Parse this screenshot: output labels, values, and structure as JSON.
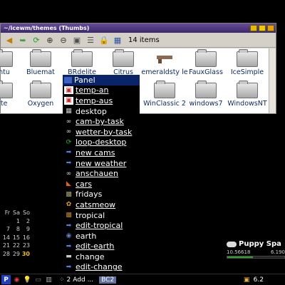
{
  "window": {
    "title": "~/icewm/themes (Thumbs)",
    "item_count": "14 items"
  },
  "folders": [
    {
      "label": "untu"
    },
    {
      "label": "Bluemat"
    },
    {
      "label": "BRdelite"
    },
    {
      "label": "Citrus"
    },
    {
      "label": "emeraldsty le"
    },
    {
      "label": "FauxGlass"
    },
    {
      "label": "IceSimple"
    },
    {
      "label": "lite"
    },
    {
      "label": "Oxygen"
    },
    {
      "label": "WinClassic 2"
    },
    {
      "label": "windows7"
    },
    {
      "label": "WindowsNT"
    }
  ],
  "menu": [
    {
      "label": "Panel",
      "icon": "panel-icon"
    },
    {
      "label": "temp-an",
      "icon": "red-image-icon"
    },
    {
      "label": "temp-aus",
      "icon": "red-image-icon"
    },
    {
      "label": "desktop",
      "icon": "grid-icon"
    },
    {
      "label": "cam-by-task",
      "icon": "binoculars-icon"
    },
    {
      "label": "wetter-by-task",
      "icon": "binoculars-icon"
    },
    {
      "label": "loop-desktop",
      "icon": "green-refresh-icon"
    },
    {
      "label": "new cams",
      "icon": "arrow-right-icon"
    },
    {
      "label": "new weather",
      "icon": "arrow-right-icon"
    },
    {
      "label": "anschauen",
      "icon": "binoculars-icon"
    },
    {
      "label": "cars",
      "icon": "car-icon"
    },
    {
      "label": "fridays",
      "icon": "image-icon"
    },
    {
      "label": "catsmeow",
      "icon": "paw-icon"
    },
    {
      "label": "tropical",
      "icon": "image-icon"
    },
    {
      "label": "edit-tropical",
      "icon": "arrow-right-icon"
    },
    {
      "label": "earth",
      "icon": "earth-icon"
    },
    {
      "label": "edit-earth",
      "icon": "arrow-right-icon"
    },
    {
      "label": "change",
      "icon": "window-icon"
    },
    {
      "label": "edit-change",
      "icon": "arrow-right-icon"
    }
  ],
  "calendar": {
    "headers": [
      "Fr",
      "Sa",
      "So"
    ],
    "rows": [
      [
        "",
        "1",
        "2"
      ],
      [
        "7",
        "8",
        "9"
      ],
      [
        "14",
        "15",
        "16"
      ],
      [
        "21",
        "22",
        "23"
      ],
      [
        "28",
        "29",
        "30"
      ]
    ],
    "highlight": "30"
  },
  "monitor": {
    "title": "Puppy Spa",
    "left_value": "10.56618",
    "right_value": "6.190",
    "fill": 0.45
  },
  "taskbar": {
    "start_label": "P",
    "task_number": "2",
    "task_label": "Add ...",
    "active_label": "BC2",
    "tray_number": "6.2"
  },
  "colors": {
    "menu_highlight": "#0a246a",
    "calendar_highlight": "#f0c020",
    "monitor_bar": "#2ca02c"
  }
}
